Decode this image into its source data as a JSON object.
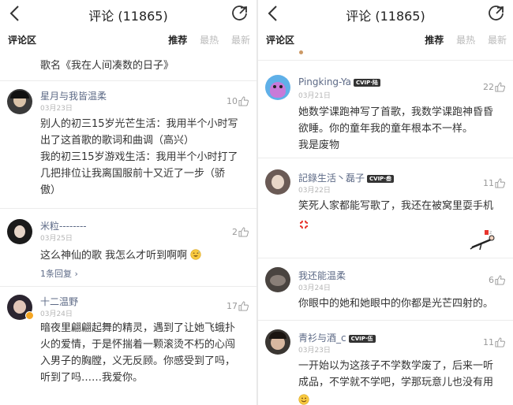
{
  "header": {
    "title": "评论 (11865)"
  },
  "tabs": {
    "section_label": "评论区",
    "items": [
      "推荐",
      "最热",
      "最新"
    ]
  },
  "left": {
    "snippet": "歌名《我在人间凑数的日子》",
    "comments": [
      {
        "name": "星月与我皆温柔",
        "date": "03月23日",
        "likes": "10",
        "lines": [
          "别人的初三15岁光芒生活：我用半个小时写",
          "出了这首歌的歌词和曲调（高兴）",
          "我的初三15岁游戏生活：我用半个小时打了",
          "几把排位让我离国服前十又近了一步（骄",
          "傲）"
        ]
      },
      {
        "name": "米粒--------",
        "date": "03月25日",
        "likes": "2",
        "lines": [
          "这么神仙的歌 我怎么才听到啊啊"
        ],
        "reply": "1条回复 ›"
      },
      {
        "name": "十二温野",
        "date": "03月24日",
        "likes": "17",
        "lines": [
          "暗夜里翩翩起舞的精灵，遇到了让她飞蛾扑",
          "火的爱情，于是怀揣着一颗滚烫不朽的心闯",
          "入男子的胸膛，义无反顾。你感受到了吗，",
          "听到了吗……我爱你。"
        ]
      }
    ]
  },
  "right": {
    "comments": [
      {
        "name": "Pingking-Ya",
        "badge": "CVIP·陆",
        "date": "03月21日",
        "likes": "22",
        "lines": [
          "她数学课跑神写了首歌，我数学课跑神昏昏",
          "欲睡。你的童年我的童年根本不一样。",
          "我是废物"
        ]
      },
      {
        "name": "記錄生活丶磊子",
        "badge": "CVIP·叁",
        "date": "03月22日",
        "likes": "11",
        "lines": [
          "笑死人家都能写歌了，我还在被窝里耍手机"
        ]
      },
      {
        "name": "我还能温柔",
        "date": "03月24日",
        "likes": "6",
        "lines": [
          "你眼中的她和她眼中的你都是光芒四射的。"
        ]
      },
      {
        "name": "青衫与酒_c",
        "badge": "CVIP·伍",
        "date": "03月23日",
        "likes": "11",
        "lines": [
          "一开始以为这孩子不学数学废了，后来一听",
          "成品，不学就不学吧，学那玩意儿也没有用"
        ]
      }
    ]
  },
  "colors": {
    "username": "#5d6a86",
    "date": "#b5b5b5",
    "muted_tab": "#bbbbbb",
    "badge_bg": "#333333"
  }
}
